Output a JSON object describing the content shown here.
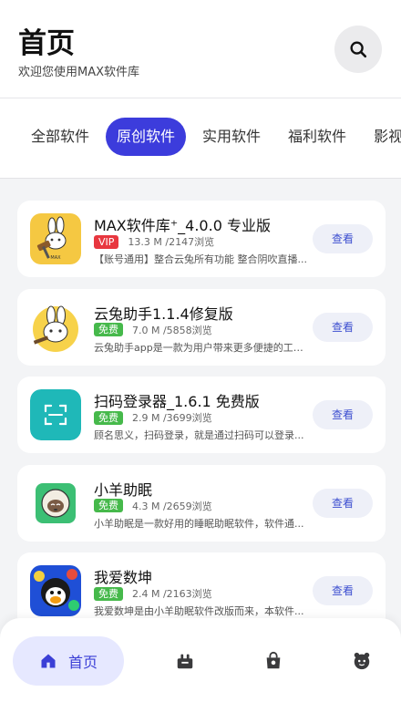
{
  "header": {
    "title": "首页",
    "subtitle": "欢迎您使用MAX软件库",
    "search_icon": "search-icon"
  },
  "tabs": [
    {
      "label": "全部软件",
      "active": false
    },
    {
      "label": "原创软件",
      "active": true
    },
    {
      "label": "实用软件",
      "active": false
    },
    {
      "label": "福利软件",
      "active": false
    },
    {
      "label": "影视音乐",
      "active": false
    }
  ],
  "apps": [
    {
      "name": "MAX软件库⁺_4.0.0 专业版",
      "badge": "VIP",
      "badge_color": "#e8373f",
      "meta": "13.3 M /2147浏览",
      "desc": "【账号通用】整合云兔所有功能 整合阴吹直播...",
      "button": "查看",
      "icon": "bunny-hammer-icon"
    },
    {
      "name": "云兔助手1.1.4修复版",
      "badge": "免费",
      "badge_color": "#46b94b",
      "meta": "7.0 M /5858浏览",
      "desc": "云兔助手app是一款为用户带来更多便捷的工具...",
      "button": "查看",
      "icon": "bunny-avatar-icon"
    },
    {
      "name": "扫码登录器_1.6.1 免费版",
      "badge": "免费",
      "badge_color": "#46b94b",
      "meta": "2.9 M /3699浏览",
      "desc": "顾名思义，扫码登录，就是通过扫码可以登录...",
      "button": "查看",
      "icon": "scan-code-icon"
    },
    {
      "name": "小羊助眠",
      "badge": "免费",
      "badge_color": "#46b94b",
      "meta": "4.3 M /2659浏览",
      "desc": "小羊助眠是一款好用的睡眠助眠软件，软件通...",
      "button": "查看",
      "icon": "sheep-icon"
    },
    {
      "name": "我爱数坤",
      "badge": "免费",
      "badge_color": "#46b94b",
      "meta": "2.4 M /2163浏览",
      "desc": "我爱数坤是由小羊助眠软件改版而来，本软件...",
      "button": "查看",
      "icon": "chicken-avatar-icon"
    }
  ],
  "bottom_nav": {
    "home_label": "首页",
    "items": [
      "home-icon",
      "store-icon",
      "bag-icon",
      "profile-icon"
    ]
  }
}
